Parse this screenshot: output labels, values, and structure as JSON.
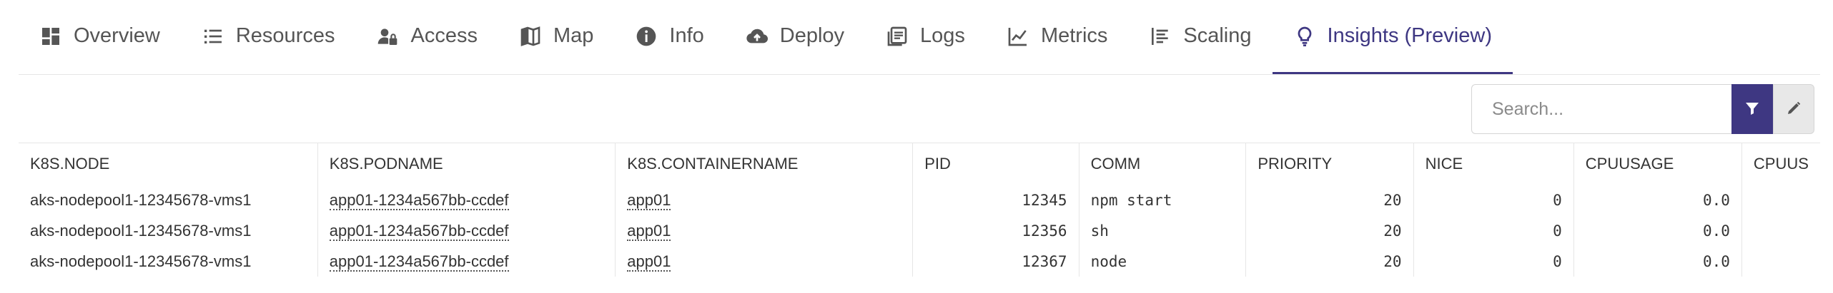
{
  "tabs": [
    {
      "label": "Overview",
      "icon": "dashboard-icon"
    },
    {
      "label": "Resources",
      "icon": "list-icon"
    },
    {
      "label": "Access",
      "icon": "user-lock-icon"
    },
    {
      "label": "Map",
      "icon": "map-icon"
    },
    {
      "label": "Info",
      "icon": "info-icon"
    },
    {
      "label": "Deploy",
      "icon": "cloud-upload-icon"
    },
    {
      "label": "Logs",
      "icon": "logs-icon"
    },
    {
      "label": "Metrics",
      "icon": "chart-line-icon"
    },
    {
      "label": "Scaling",
      "icon": "scaling-icon"
    },
    {
      "label": "Insights (Preview)",
      "icon": "lightbulb-icon",
      "active": true
    }
  ],
  "accent_color": "#3e3782",
  "search": {
    "placeholder": "Search...",
    "value": ""
  },
  "table": {
    "columns": [
      "K8S.NODE",
      "K8S.PODNAME",
      "K8S.CONTAINERNAME",
      "PID",
      "COMM",
      "PRIORITY",
      "NICE",
      "CPUUSAGE",
      "CPUUS"
    ],
    "rows": [
      [
        "aks-nodepool1-12345678-vms1",
        "app01-1234a567bb-ccdef",
        "app01",
        "12345",
        "npm start",
        "20",
        "0",
        "0.0",
        ""
      ],
      [
        "aks-nodepool1-12345678-vms1",
        "app01-1234a567bb-ccdef",
        "app01",
        "12356",
        "sh",
        "20",
        "0",
        "0.0",
        ""
      ],
      [
        "aks-nodepool1-12345678-vms1",
        "app01-1234a567bb-ccdef",
        "app01",
        "12367",
        "node",
        "20",
        "0",
        "0.0",
        ""
      ]
    ]
  }
}
